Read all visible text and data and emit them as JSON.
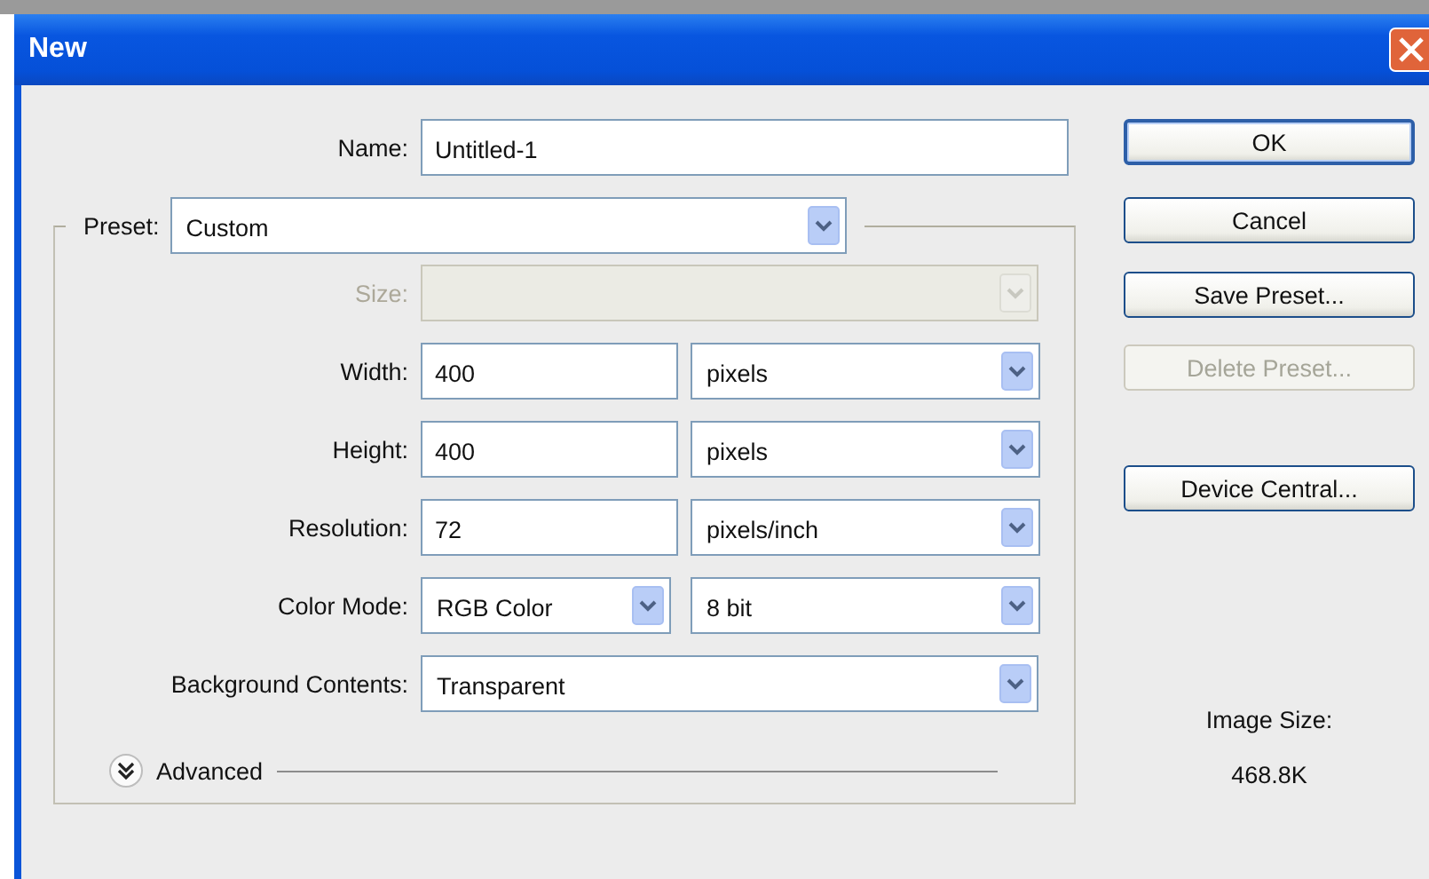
{
  "window": {
    "title": "New"
  },
  "name": {
    "label": "Name:",
    "value": "Untitled-1"
  },
  "preset": {
    "label": "Preset:",
    "value": "Custom"
  },
  "fields": [
    {
      "kind": "select",
      "label": "Size:",
      "disabled": true
    },
    {
      "kind": "number_unit",
      "label": "Width:",
      "value": "400",
      "unit": "pixels",
      "disabled": false
    },
    {
      "kind": "number_unit",
      "label": "Height:",
      "value": "400",
      "unit": "pixels",
      "disabled": false
    },
    {
      "kind": "number_unit",
      "label": "Resolution:",
      "value": "72",
      "unit": "pixels/inch",
      "disabled": false
    },
    {
      "kind": "select_pair",
      "label": "Color Mode:",
      "value": "RGB Color",
      "unit": "8 bit",
      "disabled": false
    },
    {
      "kind": "select",
      "label": "Background Contents:",
      "value": "Transparent",
      "disabled": false
    }
  ],
  "advanced": {
    "label": "Advanced",
    "expanded": false
  },
  "buttons": [
    {
      "label": "OK",
      "default": true,
      "disabled": false
    },
    {
      "label": "Cancel",
      "default": false,
      "disabled": false
    },
    {
      "label": "Save Preset...",
      "default": false,
      "disabled": false
    },
    {
      "label": "Delete Preset...",
      "default": false,
      "disabled": true
    },
    {
      "label": "Device Central...",
      "default": false,
      "disabled": false
    }
  ],
  "image_size": {
    "label": "Image Size:",
    "value": "468.8K"
  }
}
